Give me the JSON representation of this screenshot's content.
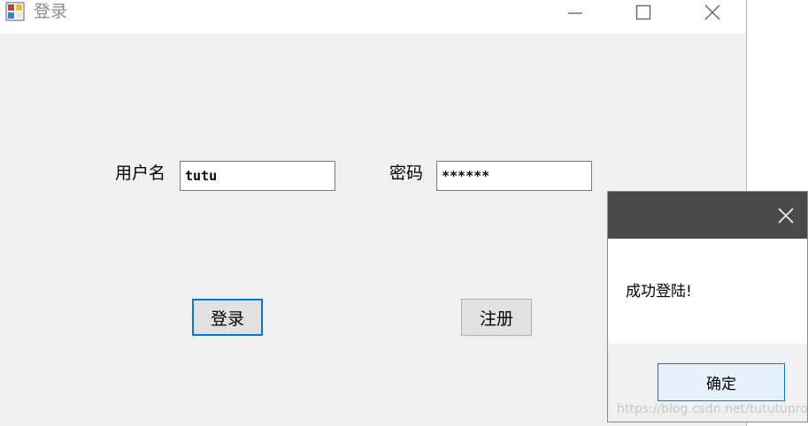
{
  "window": {
    "title": "登录",
    "icons": {
      "app": "app-icon",
      "minimize": "minimize-icon",
      "maximize": "maximize-icon",
      "close": "close-icon"
    }
  },
  "form": {
    "username_label": "用户名",
    "username_value": "tutu",
    "password_label": "密码",
    "password_value": "******",
    "login_button": "登录",
    "register_button": "注册"
  },
  "dialog": {
    "message": "成功登陆!",
    "ok_button": "确定",
    "close_icon": "close-icon"
  },
  "watermark": "https://blog.csdn.net/tututupro",
  "colors": {
    "window_bg": "#f0f0f0",
    "dialog_titlebar": "#4a4a4a",
    "focus_accent": "#0078d7",
    "ok_button_bg": "#e5f1fb"
  }
}
